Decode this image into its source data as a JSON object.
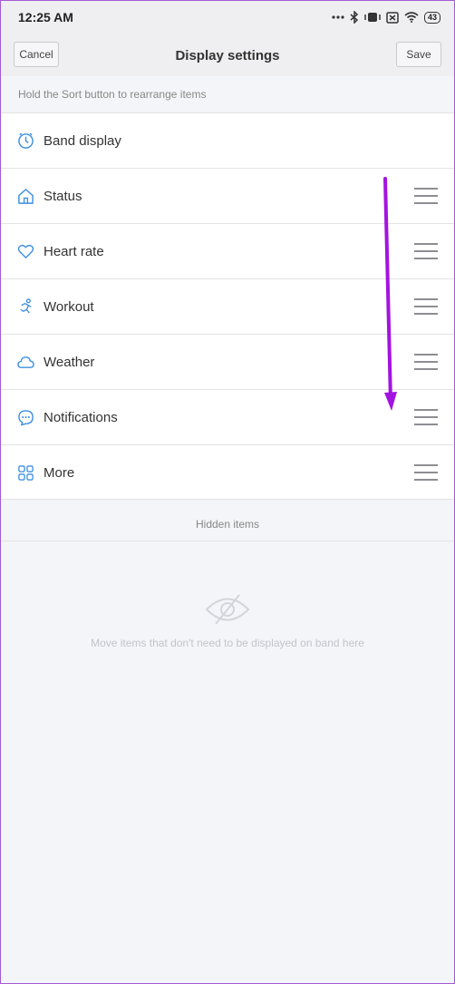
{
  "status_bar": {
    "time": "12:25 AM",
    "battery": "43"
  },
  "header": {
    "cancel_label": "Cancel",
    "title": "Display settings",
    "save_label": "Save"
  },
  "hint": "Hold the Sort button to rearrange items",
  "items": [
    {
      "label": "Band display",
      "icon": "clock-icon"
    },
    {
      "label": "Status",
      "icon": "home-icon"
    },
    {
      "label": "Heart rate",
      "icon": "heart-icon"
    },
    {
      "label": "Workout",
      "icon": "running-icon"
    },
    {
      "label": "Weather",
      "icon": "cloud-icon"
    },
    {
      "label": "Notifications",
      "icon": "chat-bubble-icon"
    },
    {
      "label": "More",
      "icon": "grid-icon"
    }
  ],
  "hidden_section": {
    "title": "Hidden items",
    "empty_text": "Move items that don't need to be displayed on band here",
    "icon": "eye-off-icon"
  },
  "colors": {
    "accent": "#3d8fe0",
    "annotation_arrow": "#a313e0"
  }
}
